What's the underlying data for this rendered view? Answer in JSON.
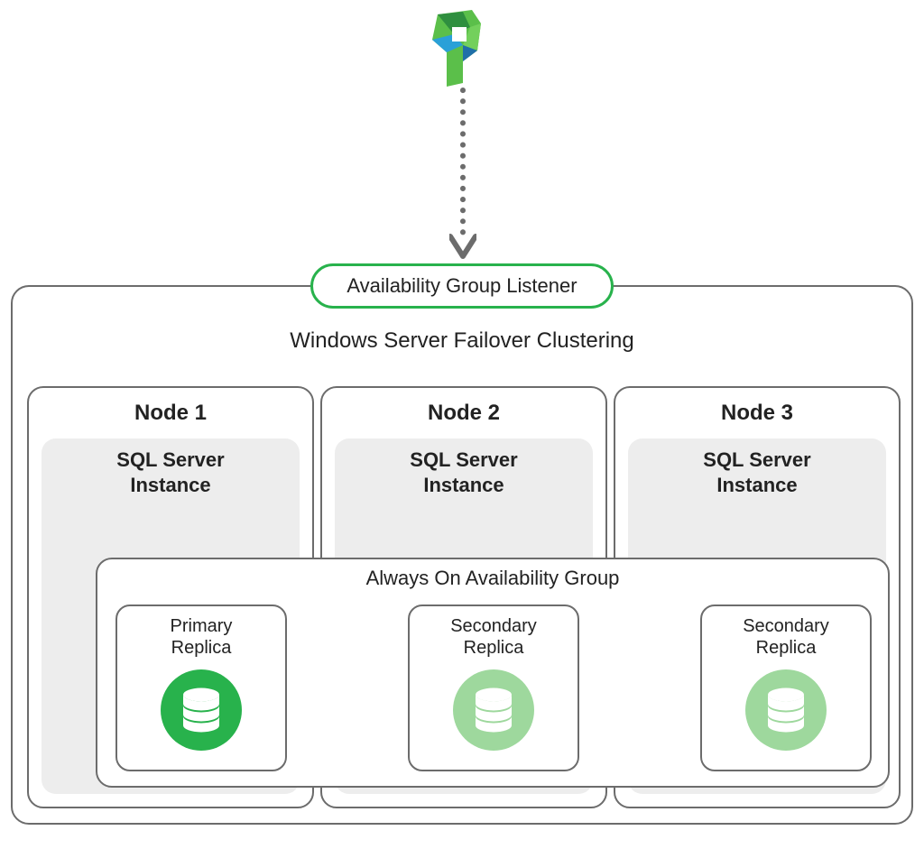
{
  "listener": {
    "label": "Availability Group Listener"
  },
  "cluster": {
    "title": "Windows Server Failover Clustering",
    "nodes": [
      {
        "title": "Node 1",
        "instance_line1": "SQL Server",
        "instance_line2": "Instance"
      },
      {
        "title": "Node 2",
        "instance_line1": "SQL Server",
        "instance_line2": "Instance"
      },
      {
        "title": "Node 3",
        "instance_line1": "SQL Server",
        "instance_line2": "Instance"
      }
    ]
  },
  "aoag": {
    "title": "Always On Availability Group",
    "replicas": [
      {
        "line1": "Primary",
        "line2": "Replica",
        "color": "#28b24c"
      },
      {
        "line1": "Secondary",
        "line2": "Replica",
        "color": "#9ed89d"
      },
      {
        "line1": "Secondary",
        "line2": "Replica",
        "color": "#9ed89d"
      }
    ]
  },
  "colors": {
    "accent_green": "#28b24c",
    "light_green": "#9ed89d",
    "stroke_gray": "#6c6c6c",
    "instance_bg": "#ededed"
  }
}
